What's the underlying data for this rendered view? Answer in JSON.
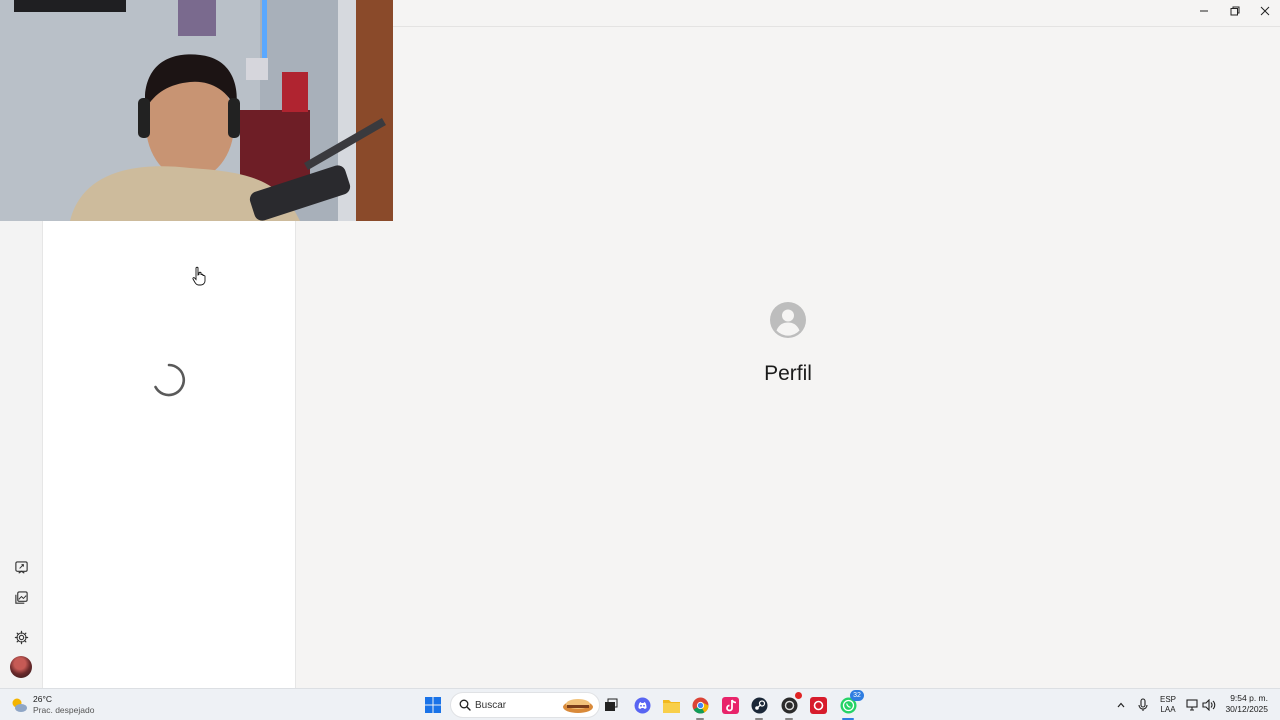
{
  "window": {
    "controls": [
      "minimize",
      "maximize",
      "close"
    ]
  },
  "nav_rail": {
    "icons": [
      "whats-new-icon",
      "gallery-icon",
      "settings-icon"
    ]
  },
  "main": {
    "title": "Perfil",
    "icon": "profile-icon"
  },
  "list_pane": {
    "state": "loading"
  },
  "taskbar": {
    "weather": {
      "temp": "26°C",
      "desc": "Prac. despejado",
      "icon": "partly-cloudy-icon"
    },
    "search": {
      "placeholder": "Buscar"
    },
    "apps": [
      {
        "name": "windows-start-icon"
      },
      {
        "name": "task-view-icon"
      },
      {
        "name": "discord-icon"
      },
      {
        "name": "file-explorer-icon"
      },
      {
        "name": "chrome-icon"
      },
      {
        "name": "capcut-icon"
      },
      {
        "name": "steam-icon"
      },
      {
        "name": "app-icon"
      },
      {
        "name": "app-red-icon"
      },
      {
        "name": "whatsapp-icon",
        "badge": "32"
      }
    ],
    "tray": {
      "lang_1": "ESP",
      "lang_2": "LAA",
      "time": "9:54 p. m.",
      "date": "30/12/2025"
    },
    "colors": {
      "accent": "#2f7de1",
      "whatsapp": "#25d366",
      "discord": "#5865f2"
    }
  }
}
